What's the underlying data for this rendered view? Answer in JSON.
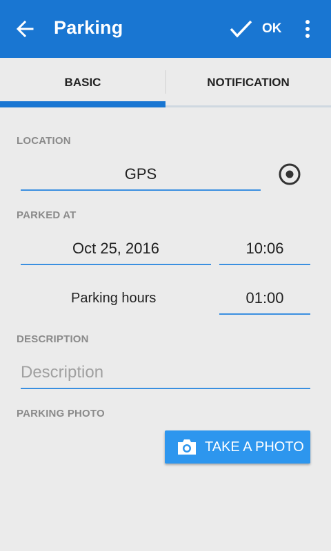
{
  "appbar": {
    "title": "Parking",
    "ok_label": "OK",
    "icons": {
      "back": "arrow-back-icon",
      "confirm": "checkmark-icon",
      "more": "more-vert-icon"
    },
    "color": "#1976d2"
  },
  "tabs": [
    {
      "label": "BASIC",
      "selected": true
    },
    {
      "label": "NOTIFICATION",
      "selected": false
    }
  ],
  "location": {
    "label": "LOCATION",
    "value": "GPS",
    "icon": "gps-target-icon"
  },
  "parked_at": {
    "label": "PARKED AT",
    "date": "Oct 25, 2016",
    "time": "10:06",
    "hours_label": "Parking hours",
    "hours_value": "01:00"
  },
  "description": {
    "label": "DESCRIPTION",
    "placeholder": "Description",
    "value": ""
  },
  "photo": {
    "label": "PARKING PHOTO",
    "button_label": "TAKE A PHOTO",
    "icon": "camera-icon",
    "button_color": "#2d96ee"
  }
}
